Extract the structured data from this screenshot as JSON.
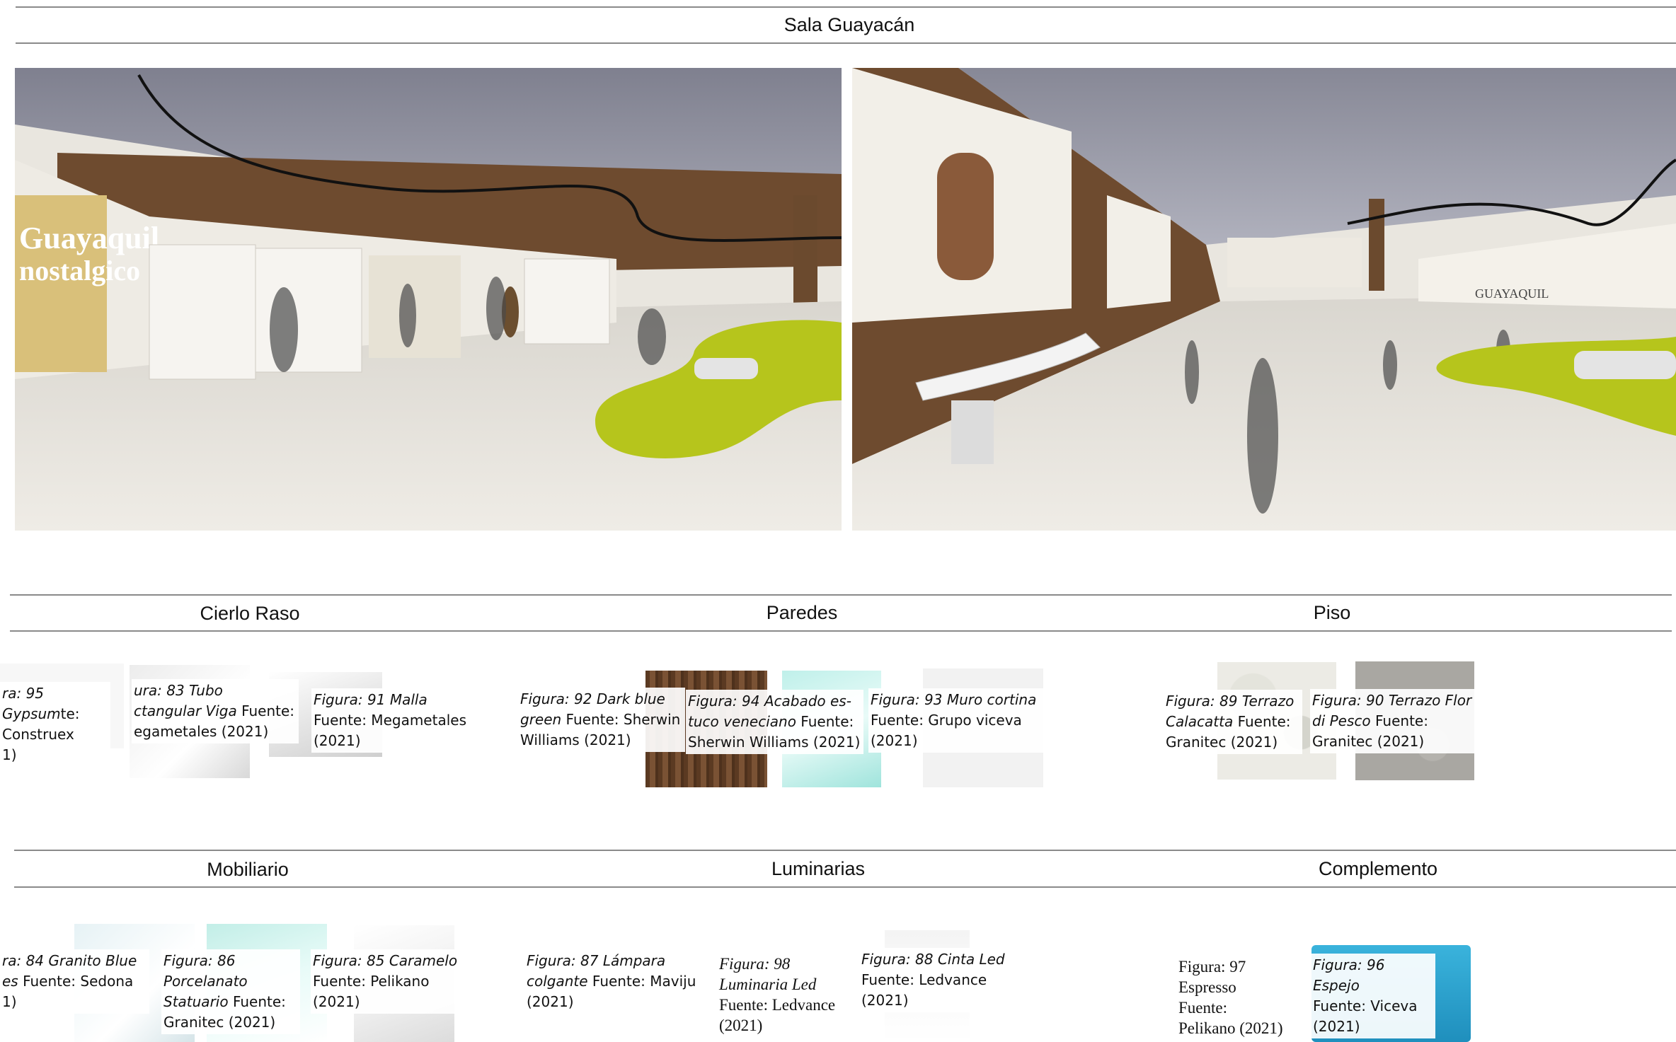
{
  "header": {
    "title": "Sala Guayacán"
  },
  "renders": {
    "left_banner_line1": "Guayaquil",
    "left_banner_line2": "nostalgico",
    "right_banner": "GUAYAQUIL"
  },
  "sections": {
    "cielo_raso": "Cierlo Raso",
    "paredes": "Paredes",
    "piso": "Piso",
    "mobiliario": "Mobiliario",
    "luminarias": "Luminarias",
    "complemento": "Complemento"
  },
  "captions": {
    "fig95": {
      "italic": "ra: 95 Gypsum",
      "plain": "te: Construex\n1)"
    },
    "fig83": {
      "italic": "ura: 83 Tubo\nctangular Viga",
      "plain": " Fuente:\negametales (2021)"
    },
    "fig91": {
      "italic": "Figura: 91 Malla",
      "plain": "\nFuente: Megametales\n(2021)"
    },
    "fig92": {
      "italic": "Figura: 92 Dark blue\ngreen",
      "plain": " Fuente: Sherwin\nWilliams (2021)"
    },
    "fig94": {
      "italic": "Figura: 94 Acabado es-\ntuco veneciano",
      "plain": " Fuente:\nSherwin Williams (2021)"
    },
    "fig93": {
      "italic": "Figura: 93 Muro cortina",
      "plain": "\nFuente: Grupo viceva\n(2021)"
    },
    "fig89": {
      "italic": "Figura: 89 Terrazo\nCalacatta",
      "plain": " Fuente:\nGranitec (2021)"
    },
    "fig90": {
      "italic": "Figura: 90 Terrazo Flor\ndi Pesco",
      "plain": " Fuente:\nGranitec (2021)"
    },
    "fig84": {
      "italic": "ra: 84 Granito Blue\nes",
      "plain": " Fuente: Sedona\n1)"
    },
    "fig86": {
      "italic": "Figura: 86\nPorcelanato\nStatuario",
      "plain": " Fuente:\nGranitec (2021)"
    },
    "fig85": {
      "italic": "Figura: 85 Caramelo",
      "plain": "\nFuente: Pelikano\n(2021)"
    },
    "fig87": {
      "italic": "Figura: 87 Lámpara\ncolgante",
      "plain": " Fuente: Maviju\n(2021)"
    },
    "fig98": {
      "italic": "Figura: 98\nLuminaria Led",
      "plain": "\nFuente: Ledvance\n(2021)"
    },
    "fig88": {
      "italic": "Figura: 88 Cinta Led",
      "plain": "\nFuente: Ledvance\n(2021)"
    },
    "fig97": {
      "italic": "Figura: 97\nEspresso",
      "plain": "\nFuente:\nPelikano (2021)"
    },
    "fig96": {
      "italic": "Figura: 96 Espejo",
      "plain": "\nFuente: Viceva\n(2021)"
    }
  },
  "colors": {
    "bench_green": "#b6c51c",
    "wood_wall": "#6e4b2f",
    "ceiling": "#8d8e9c",
    "terrazzo": "#e6e3dc",
    "sofa_blue": "#2fa6cf"
  }
}
